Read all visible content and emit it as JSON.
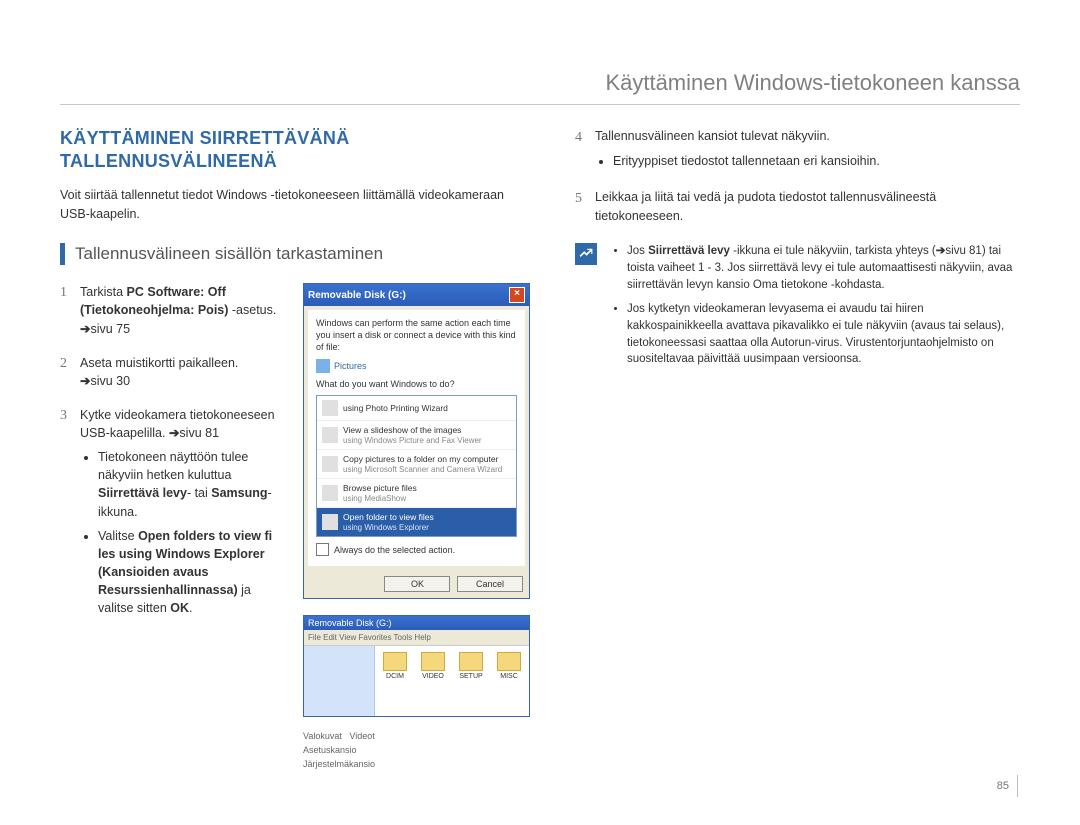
{
  "header": "Käyttäminen Windows-tietokoneen kanssa",
  "title": "KÄYTTÄMINEN SIIRRETTÄVÄNÄ TALLENNUSVÄLINEENÄ",
  "intro": "Voit siirtää tallennetut tiedot Windows -tietokoneeseen liittämällä videokameraan USB-kaapelin.",
  "subhead": "Tallennusvälineen sisällön tarkastaminen",
  "steps_left": {
    "s1_a": "Tarkista ",
    "s1_b": "PC Software: Off (Tietokoneohjelma: Pois)",
    "s1_c": " -asetus. ",
    "s1_d": "sivu 75",
    "s2_a": "Aseta muistikortti paikalleen. ",
    "s2_b": "sivu 30",
    "s3_a": "Kytke videokamera tietokoneeseen USB-kaapelilla. ",
    "s3_b": "sivu 81",
    "s3_sub1_a": "Tietokoneen näyttöön tulee näkyviin hetken kuluttua ",
    "s3_sub1_b": "Siirrettävä levy",
    "s3_sub1_c": "- tai ",
    "s3_sub1_d": "Samsung",
    "s3_sub1_e": "-ikkuna.",
    "s3_sub2_a": "Valitse ",
    "s3_sub2_b": "Open folders to view fi les using Windows Explorer (Kansioiden avaus Resurssienhallinnassa)",
    "s3_sub2_c": " ja valitse sitten ",
    "s3_sub2_d": "OK",
    "s3_sub2_e": "."
  },
  "dialog": {
    "title": "Removable Disk (G:)",
    "prompt": "Windows can perform the same action each time you insert a disk or connect a device with this kind of file:",
    "picHeader": "Pictures",
    "ask": "What do you want Windows to do?",
    "opt1_t": "using Photo Printing Wizard",
    "opt2_t": "View a slideshow of the images",
    "opt2_s": "using Windows Picture and Fax Viewer",
    "opt3_t": "Copy pictures to a folder on my computer",
    "opt3_s": "using Microsoft Scanner and Camera Wizard",
    "opt4_t": "Browse picture files",
    "opt4_s": "using MediaShow",
    "opt5_t": "Open folder to view files",
    "opt5_s": "using Windows Explorer",
    "always": "Always do the selected action.",
    "ok": "OK",
    "cancel": "Cancel"
  },
  "explorer": {
    "title": "Removable Disk (G:)",
    "toolbar": "File   Edit   View   Favorites   Tools   Help",
    "f1": "DCIM",
    "f2": "VIDEO",
    "f3": "SETUP",
    "f4": "MISC"
  },
  "callouts": {
    "c1": "Valokuvat",
    "c2": "Videot",
    "c3": "Asetuskansio",
    "c4": "Järjestelmäkansio"
  },
  "steps_right": {
    "s4_a": "Tallennusvälineen kansiot tulevat näkyviin.",
    "s4_sub1": "Erityyppiset tiedostot tallennetaan eri kansioihin.",
    "s5": "Leikkaa ja liitä tai vedä ja pudota tiedostot tallennusvälineestä tietokoneeseen."
  },
  "notes": {
    "n1_a": "Jos ",
    "n1_b": "Siirrettävä levy",
    "n1_c": " -ikkuna ei tule näkyviin, tarkista yhteys (",
    "n1_d": "sivu 81) tai toista vaiheet 1 - 3. Jos siirrettävä levy ei tule automaattisesti näkyviin, avaa siirrettävän levyn kansio Oma tietokone -kohdasta.",
    "n2": "Jos kytketyn videokameran levyasema ei avaudu tai hiiren kakkospainikkeella avattava pikavalikko ei tule näkyviin (avaus tai selaus), tietokoneessasi saattaa olla Autorun-virus. Virustentorjuntaohjelmisto on suositeltavaa päivittää uusimpaan versioonsa."
  },
  "pageNumber": "85"
}
